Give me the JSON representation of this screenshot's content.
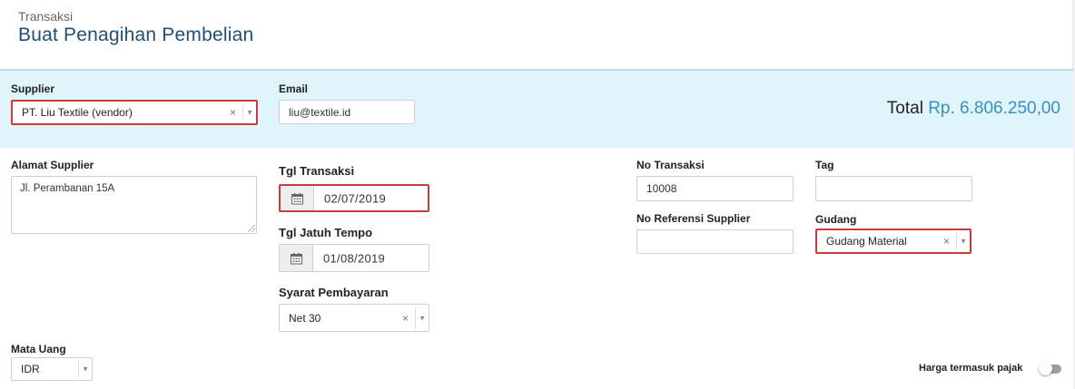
{
  "header": {
    "breadcrumb": "Transaksi",
    "title": "Buat Penagihan Pembelian"
  },
  "supplier": {
    "label": "Supplier",
    "value": "PT. Liu Textile (vendor)",
    "clear_glyph": "×",
    "arrow_glyph": "▼"
  },
  "email": {
    "label": "Email",
    "value": "liu@textile.id"
  },
  "total": {
    "label": "Total",
    "value": "Rp. 6.806.250,00",
    "color": "#3a8fc4"
  },
  "alamat": {
    "label": "Alamat Supplier",
    "value": "Jl. Perambanan 15A"
  },
  "tgl_transaksi": {
    "label": "Tgl Transaksi",
    "value": "02/07/2019",
    "icon": "calendar-icon"
  },
  "tgl_jatuh_tempo": {
    "label": "Tgl Jatuh Tempo",
    "value": "01/08/2019",
    "icon": "calendar-icon"
  },
  "syarat": {
    "label": "Syarat Pembayaran",
    "value": "Net 30",
    "clear_glyph": "×",
    "arrow_glyph": "▼"
  },
  "no_transaksi": {
    "label": "No Transaksi",
    "value": "10008"
  },
  "no_referensi": {
    "label": "No Referensi Supplier",
    "value": ""
  },
  "tag": {
    "label": "Tag",
    "value": ""
  },
  "gudang": {
    "label": "Gudang",
    "value": "Gudang Material",
    "clear_glyph": "×",
    "arrow_glyph": "▼"
  },
  "mata_uang": {
    "label": "Mata Uang",
    "value": "IDR",
    "arrow_glyph": "▼"
  },
  "harga_pajak": {
    "label": "Harga termasuk pajak",
    "on": false
  },
  "colors": {
    "title": "#1f4e79",
    "highlight_border": "#cc3b3b",
    "band_background": "#dff4fb"
  }
}
